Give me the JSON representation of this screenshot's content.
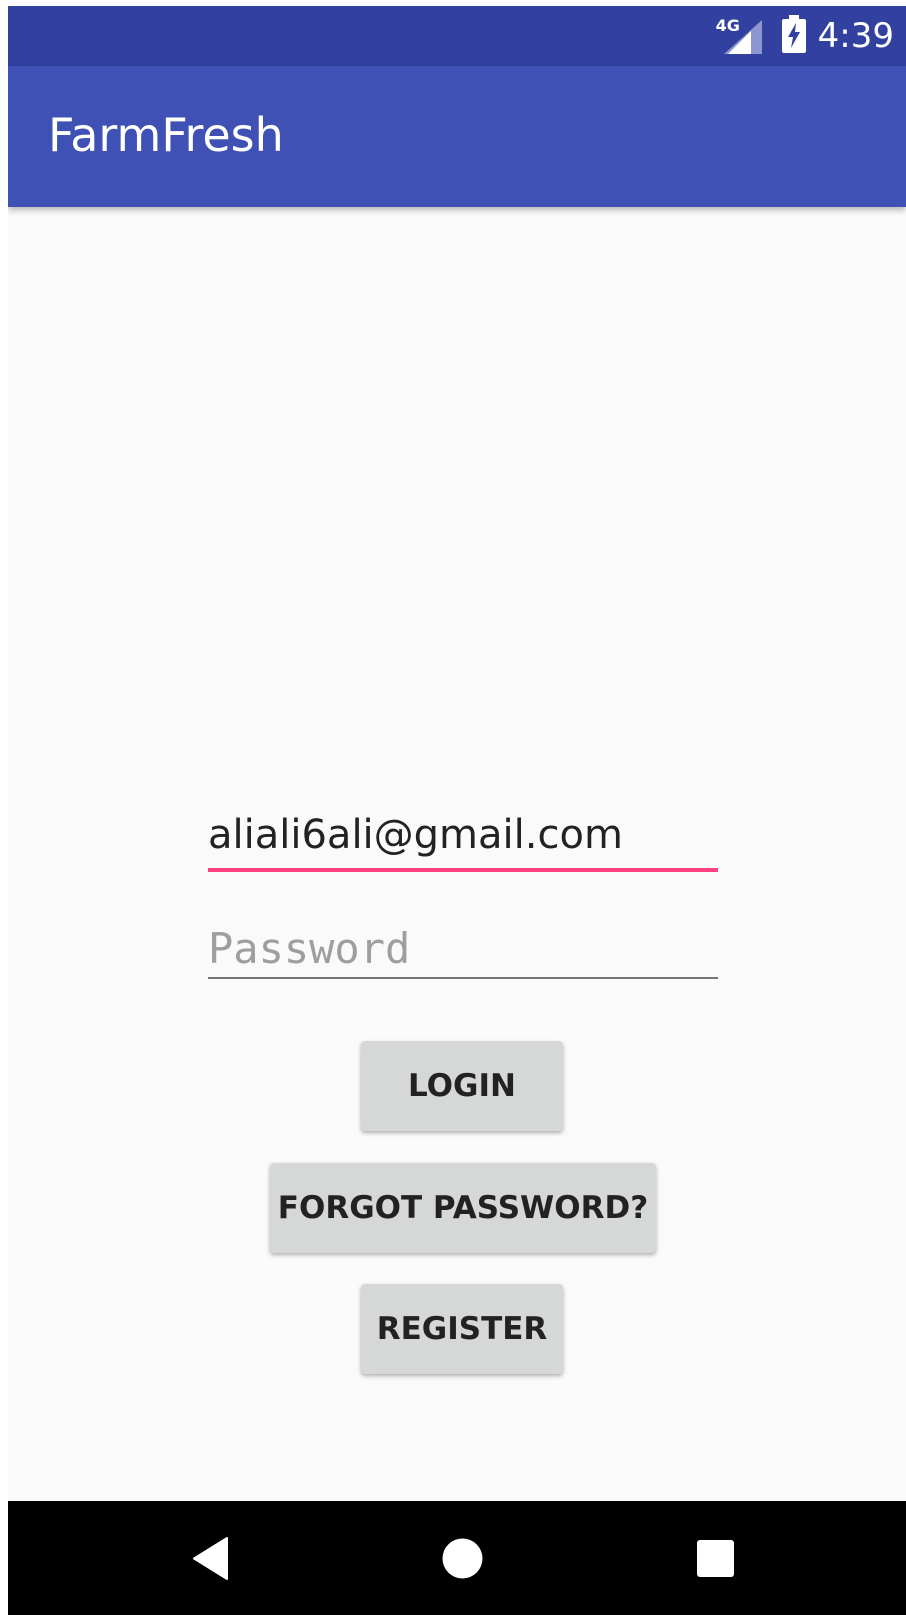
{
  "status_bar": {
    "network_label": "4G",
    "time": "4:39",
    "icons": [
      "signal-4g-icon",
      "battery-charging-icon"
    ]
  },
  "app_bar": {
    "title": "FarmFresh"
  },
  "login_form": {
    "email_value": "aliali6ali@gmail.com",
    "password_placeholder": "Password",
    "login_label": "LOGIN",
    "forgot_label": "FORGOT PASSWORD?",
    "register_label": "REGISTER"
  },
  "nav_bar": {
    "icons": [
      "back-icon",
      "home-icon",
      "recents-icon"
    ]
  },
  "colors": {
    "status_bar": "#3240a0",
    "app_bar": "#3f51b5",
    "accent_underline": "#ff4081",
    "button_bg": "#d6d7d7",
    "background": "#fafafa"
  }
}
